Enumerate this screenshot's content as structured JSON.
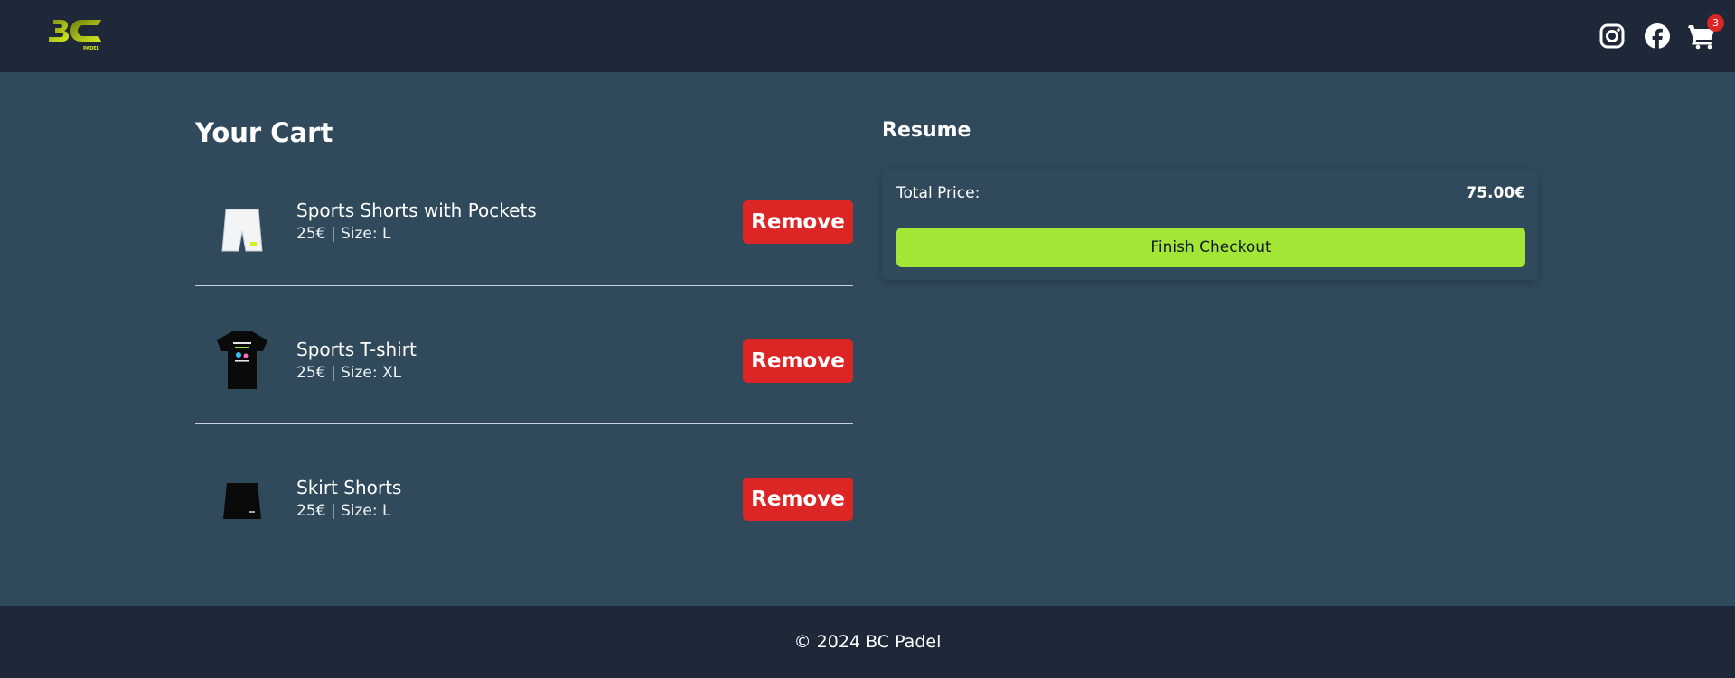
{
  "header": {
    "logo_text": "BC",
    "logo_subtext": "PADEL",
    "icons": [
      "instagram-icon",
      "facebook-icon",
      "cart-icon"
    ],
    "cart_count": "3"
  },
  "cart": {
    "title": "Your Cart",
    "remove_label": "Remove",
    "items": [
      {
        "name": "Sports Shorts with Pockets",
        "meta": "25€ | Size: L",
        "image": "white-shorts"
      },
      {
        "name": "Sports T-shirt",
        "meta": "25€ | Size: XL",
        "image": "black-tshirt"
      },
      {
        "name": "Skirt Shorts",
        "meta": "25€ | Size: L",
        "image": "black-skirt"
      }
    ]
  },
  "resume": {
    "title": "Resume",
    "total_label": "Total Price:",
    "total_value": "75.00€",
    "checkout_label": "Finish Checkout"
  },
  "footer": {
    "copyright": "© 2024 BC Padel"
  },
  "colors": {
    "header_bg": "#1f2839",
    "page_bg": "#304a5c",
    "remove": "#dc2626",
    "checkout": "#a3e635",
    "brand": "#c6e61b"
  }
}
